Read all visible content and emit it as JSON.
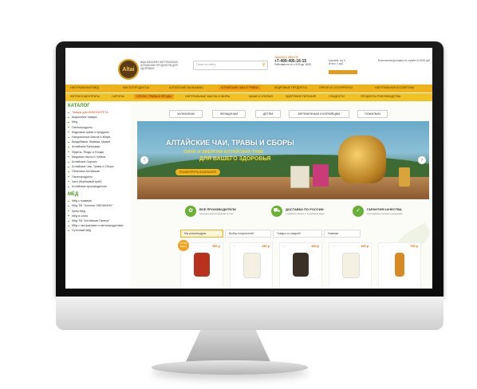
{
  "header": {
    "logo_text": "Altai",
    "tagline": "ВАШ МАГАЗИН НАТУРАЛЬНЫХ АЛТАЙСКИХ ПРОДУКТОВ ДЛЯ ЗДОРОВЬЯ",
    "search_placeholder": "Поиск по сайту",
    "search_icon": "search-icon",
    "request_call": "ЗАКАЗАТЬ ЗВОНОК",
    "phone": "+7-499-495-16-15",
    "phone_note": "Работаем пн-пт с 9:00 до 18:00",
    "cart_label": "Корзина: шт. 0",
    "cart_sum": "Итого: 0 руб.",
    "cart_note": "Бесплатная доставка по стране от 5000 руб"
  },
  "nav": {
    "row1": [
      "НАТУРАЛЬНЫЙ МЁД",
      "МАСЛОПРОДУКТЫ",
      "АЛТАЙСКИЕ БАЛЬЗАМЫ",
      "АЛТАЙСКИЕ ЧАИ И ТРАВЫ",
      "КЕДРОВЫЕ ПРОДУКТЫ",
      "ОРЕХИ И СУХОФРУКТЫ",
      "НАТУРАЛЬНАЯ КОСМЕТИКА"
    ],
    "row2": [
      "ФИТОКОНЦЕНТРАТЫ",
      "СИРОПЫ",
      "ОРЕХИ, ТРАВЫ И ЯГОДЫ",
      "НАТУРАЛЬНЫЕ МАСЛА И ЖИРЫ",
      "КАШИ И ХЛОПЬЯ",
      "ЗДОРОВОЕ ПИТАНИЕ",
      "СЛАДОСТИ",
      "ПРОДУКТЫ ПЧЕЛОВОДСТВА"
    ]
  },
  "sidebar": {
    "catalog_title": "КАТАЛОГ",
    "catalog_items": [
      "Товары для ИММУНИТЕТА",
      "Акционные товары",
      "Мёд",
      "Пантопродукты",
      "Кедровые орехи и продукты",
      "Натуральные Масла и Жиры",
      "Биодобавки, Живица, Мумиё",
      "Алтайские Бальзамы",
      "Фрукты, Ягоды и Плоды",
      "Медовые пасты и Урбечи",
      "Алтайские Сиропы",
      "Алтайские Чаи, Травы и Сборы",
      "Облепиха Алтайская",
      "Пантопродукты",
      "Чага (берёзовый гриб)",
      "Алтайские производители"
    ],
    "honey_title": "МЁД",
    "honey_items": [
      "Мёд с травами",
      "Мёд ТМ \"Золотое ОВЕЧКИНО\"",
      "Крем-Мёд",
      "Мёд в сотах",
      "Мёд ТМ \"Алтайская Пасека\"",
      "Мёд с экстрактами и пантопродуктами",
      "Суточный мёд"
    ]
  },
  "tabs": [
    "МУЖЧИНАМ",
    "ЖЕНЩИНАМ",
    "ДЕТЯМ",
    "БЕРЕМЕННЫМ И КОРМЯЩИМ",
    "ПОЖИЛЫМ"
  ],
  "banner": {
    "title": "АЛТАЙСКИЕ ЧАИ, ТРАВЫ И СБОРЫ",
    "subtitle": "СИЛА И ЭНЕРГИЯ АЛТАЙСКИХ ТРАВ",
    "subtitle2": "ДЛЯ ВАШЕГО ЗДОРОВЬЯ",
    "button": "ПОСМОТРЕТЬ В КАТАЛОГЕ",
    "slide_count": 4
  },
  "features": [
    {
      "title": "ВСЕ ПРОИЗВОДИТЕЛИ",
      "sub": "натуральной продукции Алтая",
      "icon": "leaf-icon"
    },
    {
      "title": "ДОСТАВКА ПО РОССИИ",
      "sub": "в удобное время и в удобном виде",
      "icon": "truck-icon"
    },
    {
      "title": "ГАРАНТИЯ КАЧЕСТВА",
      "sub": "сертификаты на всю продукцию",
      "icon": "check-icon"
    }
  ],
  "product_tabs": [
    "Мы рекомендуем",
    "Выбор покупателей",
    "Товары со скидкой",
    "Новинки"
  ],
  "products": [
    {
      "price": "390 р",
      "promo": "СУПЕР ЦЕНА",
      "color": "#b8321f"
    },
    {
      "price": "250 р",
      "promo": "",
      "color": "#f4f0e2"
    },
    {
      "price": "450 р",
      "promo": "",
      "color": "#3b3026"
    },
    {
      "price": "199 р",
      "promo": "",
      "color": "#f4f0e2"
    },
    {
      "price": "750 р",
      "promo": "",
      "color": "#d88a22"
    }
  ],
  "colors": {
    "accent": "#f0b21a",
    "green": "#6ab037",
    "orange": "#e59a1c"
  }
}
